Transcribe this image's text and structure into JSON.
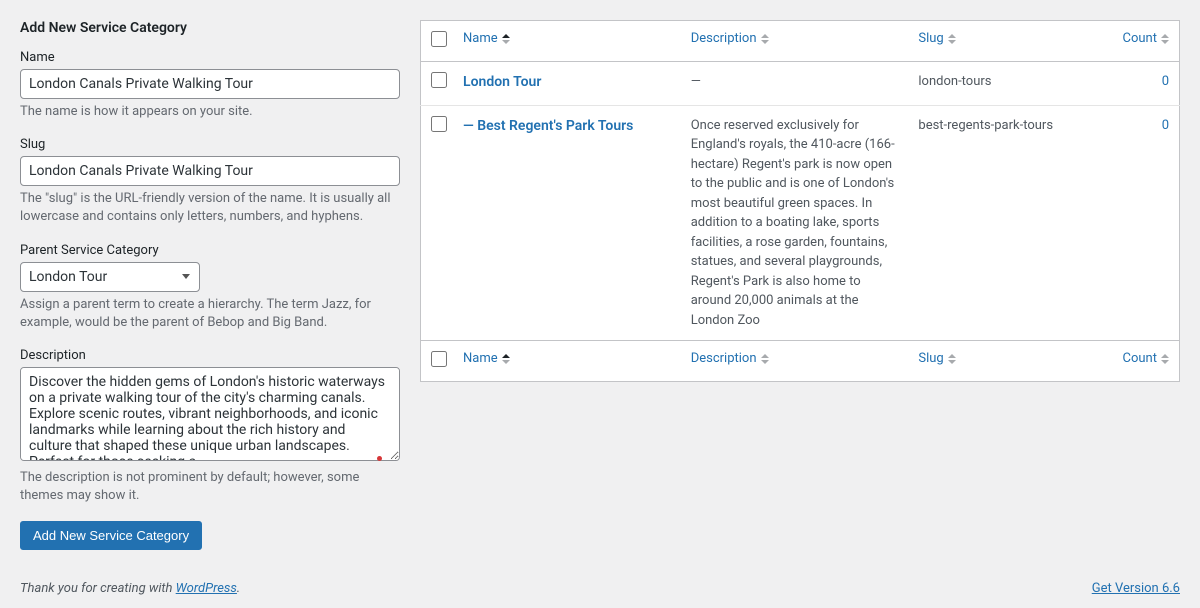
{
  "form": {
    "title": "Add New Service Category",
    "name_label": "Name",
    "name_value": "London Canals Private Walking Tour",
    "name_desc": "The name is how it appears on your site.",
    "slug_label": "Slug",
    "slug_value": "London Canals Private Walking Tour",
    "slug_desc": "The \"slug\" is the URL-friendly version of the name. It is usually all lowercase and contains only letters, numbers, and hyphens.",
    "parent_label": "Parent Service Category",
    "parent_value": "London Tour",
    "parent_desc": "Assign a parent term to create a hierarchy. The term Jazz, for example, would be the parent of Bebop and Big Band.",
    "description_label": "Description",
    "description_value": "Discover the hidden gems of London's historic waterways on a private walking tour of the city's charming canals. Explore scenic routes, vibrant neighborhoods, and iconic landmarks while learning about the rich history and culture that shaped these unique urban landscapes. Perfect for those seeking a",
    "description_desc": "The description is not prominent by default; however, some themes may show it.",
    "submit_label": "Add New Service Category"
  },
  "table": {
    "headers": {
      "name": "Name",
      "description": "Description",
      "slug": "Slug",
      "count": "Count"
    },
    "rows": [
      {
        "name": "London Tour",
        "indent": "",
        "description": "—",
        "slug": "london-tours",
        "count": "0"
      },
      {
        "name": "Best Regent's Park Tours",
        "indent": "— ",
        "description": "Once reserved exclusively for England's royals, the 410-acre (166-hectare) Regent's park is now open to the public and is one of London's most beautiful green spaces. In addition to a boating lake, sports facilities, a rose garden, fountains, statues, and several playgrounds, Regent's Park is also home to around 20,000 animals at the London Zoo",
        "slug": "best-regents-park-tours",
        "count": "0"
      }
    ]
  },
  "footer": {
    "thanks_prefix": "Thank you for creating with ",
    "thanks_link": "WordPress",
    "thanks_suffix": ".",
    "version": "Get Version 6.6"
  }
}
